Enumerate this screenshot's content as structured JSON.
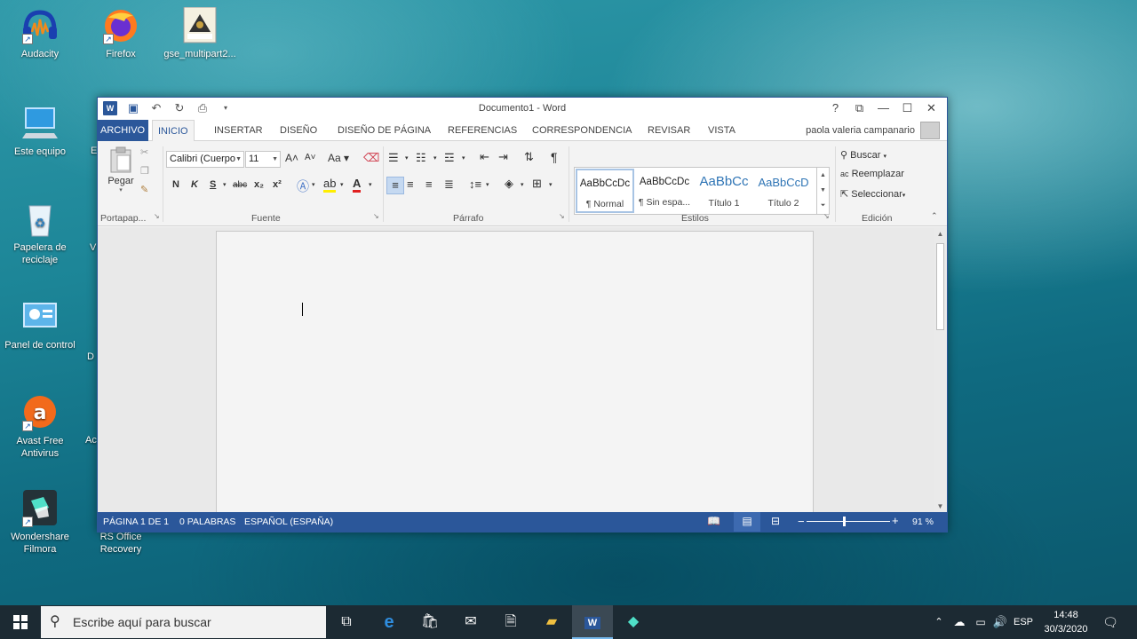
{
  "desktop": {
    "icons": [
      {
        "label": "Audacity",
        "icon": "audacity-icon"
      },
      {
        "label": "Firefox",
        "icon": "firefox-icon"
      },
      {
        "label": "gse_multipart2...",
        "icon": "idea-file-icon"
      },
      {
        "label": "Este equipo",
        "icon": "computer-icon"
      },
      {
        "label": "Papelera de reciclaje",
        "icon": "recycle-bin-icon"
      },
      {
        "label": "Panel de control",
        "icon": "control-panel-icon"
      },
      {
        "label": "Avast Free Antivirus",
        "icon": "avast-icon"
      },
      {
        "label": "Wondershare Filmora",
        "icon": "filmora-icon"
      },
      {
        "label": "RS Office Recovery",
        "icon": "rs-office-icon"
      }
    ],
    "partial_labels": [
      "E",
      "V",
      "D",
      "Ac"
    ]
  },
  "word": {
    "title": "Documento1 - Word",
    "tabs": [
      "ARCHIVO",
      "INICIO",
      "INSERTAR",
      "DISEÑO",
      "DISEÑO DE PÁGINA",
      "REFERENCIAS",
      "CORRESPONDENCIA",
      "REVISAR",
      "VISTA"
    ],
    "active_tab": "INICIO",
    "user": "paola valeria campanario",
    "ribbon": {
      "clipboard": {
        "paste_label": "Pegar",
        "group": "Portapap..."
      },
      "font": {
        "font_name": "Calibri (Cuerpo",
        "font_size": "11",
        "group": "Fuente",
        "bold": "N",
        "italic": "K",
        "underline": "S",
        "strike": "abc",
        "sub": "x₂",
        "sup": "x²",
        "case": "Aa"
      },
      "paragraph": {
        "group": "Párrafo"
      },
      "styles": {
        "group": "Estilos",
        "items": [
          {
            "preview": "AaBbCcDc",
            "name": "¶ Normal"
          },
          {
            "preview": "AaBbCcDc",
            "name": "¶ Sin espa..."
          },
          {
            "preview": "AaBbCc",
            "name": "Título 1"
          },
          {
            "preview": "AaBbCcD",
            "name": "Título 2"
          }
        ]
      },
      "editing": {
        "group": "Edición",
        "find": "Buscar",
        "replace": "Reemplazar",
        "select": "Seleccionar"
      }
    },
    "status": {
      "page": "PÁGINA 1 DE 1",
      "words": "0 PALABRAS",
      "language": "ESPAÑOL (ESPAÑA)",
      "zoom": "91 %",
      "zoom_value": 91
    }
  },
  "taskbar": {
    "search_placeholder": "Escribe aquí para buscar",
    "language": "ESP",
    "time": "14:48",
    "date": "30/3/2020"
  },
  "colors": {
    "word_blue": "#2b579a",
    "taskbar": "#1c2a33"
  }
}
